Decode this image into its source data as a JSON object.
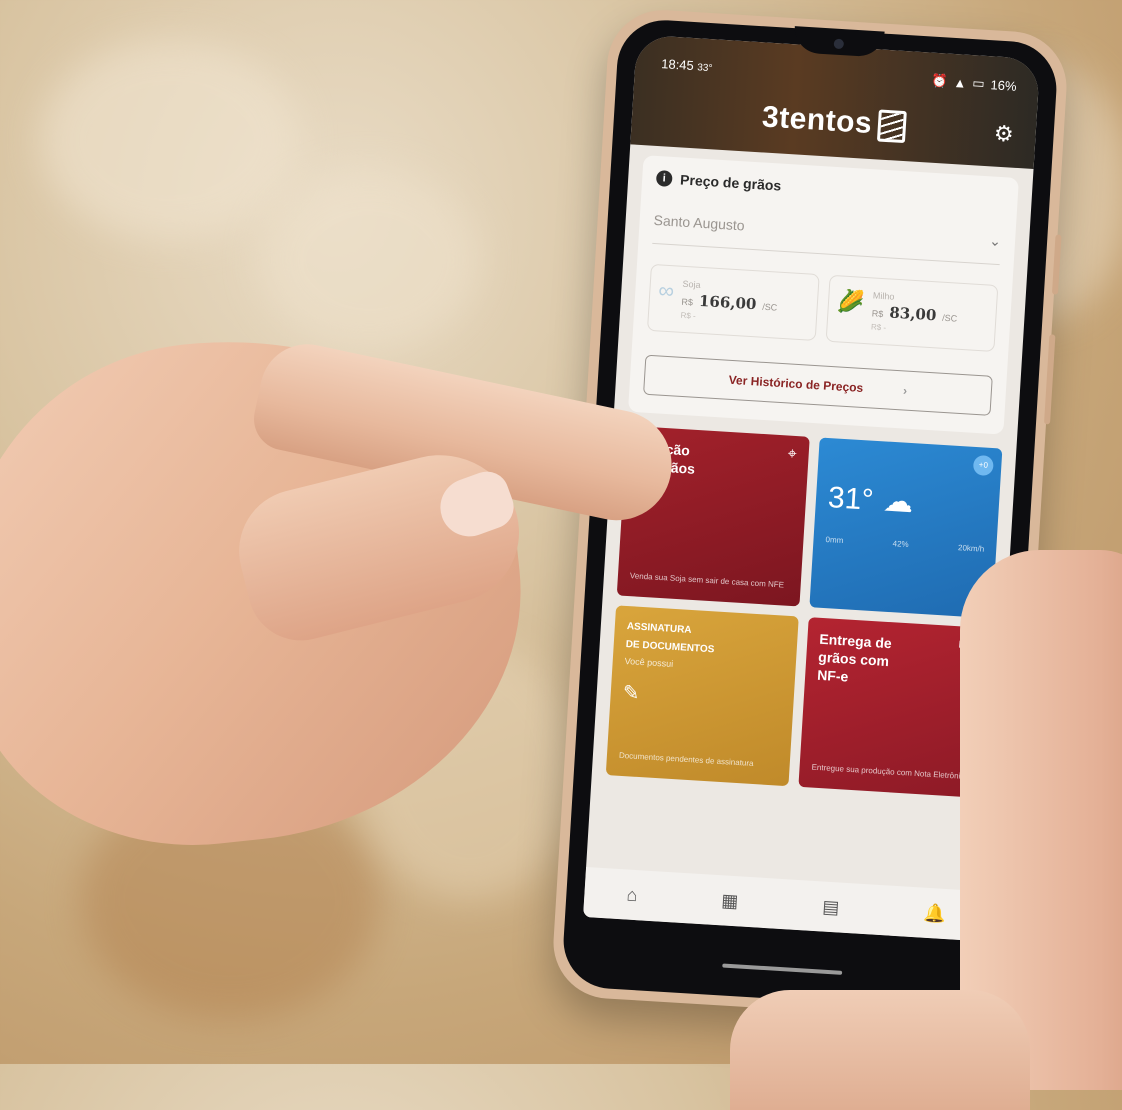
{
  "status": {
    "time": "18:45",
    "temp_small": "33°",
    "battery": "16%"
  },
  "app": {
    "brand": "3tentos",
    "settings_icon": "gear-icon"
  },
  "prices_card": {
    "title": "Preço de grãos",
    "location": "Santo Augusto",
    "items": [
      {
        "name": "Soja",
        "currency": "R$",
        "value": "166,00",
        "unit": "/SC",
        "sub": "R$ -",
        "icon": "soybean-icon"
      },
      {
        "name": "Milho",
        "currency": "R$",
        "value": "83,00",
        "unit": "/SC",
        "sub": "R$ -",
        "icon": "corn-icon"
      }
    ],
    "history_button": "Ver Histórico de Preços"
  },
  "tiles": {
    "fixacao": {
      "title_line1": "Fixação",
      "title_line2": "de grãos",
      "desc": "Venda sua Soja sem sair de casa com NFE",
      "icon": "map-pin-icon"
    },
    "weather": {
      "temperature": "31°",
      "rain": "0mm",
      "humidity": "42%",
      "wind": "20km/h",
      "badge": "+0",
      "icon": "cloud-icon"
    },
    "assinatura": {
      "title_line1": "ASSINATURA",
      "title_line2": "DE DOCUMENTOS",
      "subtitle": "Você possui",
      "desc": "Documentos pendentes de assinatura",
      "icon": "signature-icon"
    },
    "entrega": {
      "title_line1": "Entrega de",
      "title_line2": "grãos com",
      "title_line3": "NF-e",
      "desc": "Entregue sua produção com Nota Eletrônica",
      "icon": "truck-icon"
    }
  },
  "navbar": {
    "items": [
      "home-icon",
      "dashboard-icon",
      "document-icon",
      "bell-icon"
    ]
  }
}
